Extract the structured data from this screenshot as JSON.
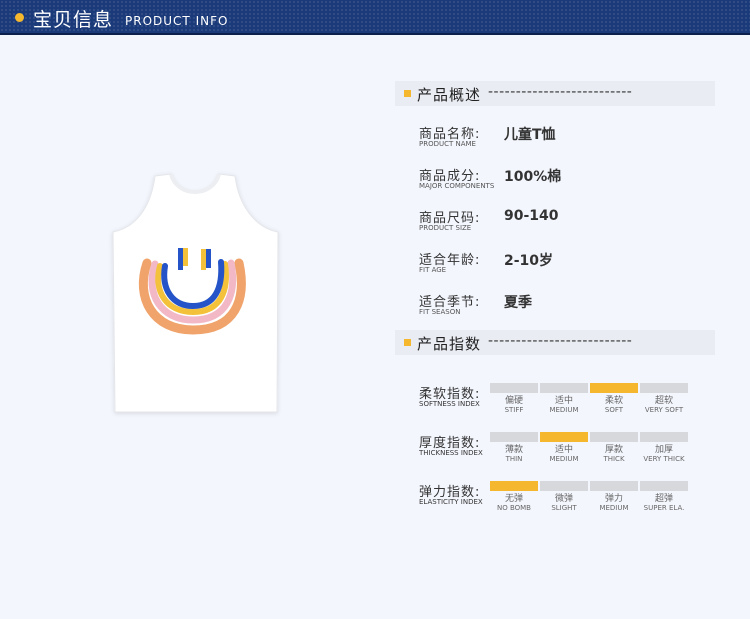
{
  "header": {
    "title_cn": "宝贝信息",
    "title_en": "PRODUCT INFO"
  },
  "overview": {
    "title": "产品概述",
    "dashes": "--------------------------",
    "rows": [
      {
        "cn": "商品名称:",
        "en": "PRODUCT NAME",
        "value": "儿童T恤"
      },
      {
        "cn": "商品成分:",
        "en": "MAJOR COMPONENTS",
        "value": "100%棉"
      },
      {
        "cn": "商品尺码:",
        "en": "PRODUCT SIZE",
        "value": "90-140"
      },
      {
        "cn": "适合年龄:",
        "en": "FIT AGE",
        "value": "2-10岁"
      },
      {
        "cn": "适合季节:",
        "en": "FIT SEASON",
        "value": "夏季"
      }
    ]
  },
  "indices": {
    "title": "产品指数",
    "dashes": "--------------------------",
    "rows": [
      {
        "cn": "柔软指数:",
        "en": "SOFTNESS INDEX",
        "selected": 2,
        "options": [
          {
            "cn": "偏硬",
            "en": "STIFF"
          },
          {
            "cn": "适中",
            "en": "MEDIUM"
          },
          {
            "cn": "柔软",
            "en": "SOFT"
          },
          {
            "cn": "超软",
            "en": "VERY SOFT"
          }
        ]
      },
      {
        "cn": "厚度指数:",
        "en": "THICKNESS INDEX",
        "selected": 1,
        "options": [
          {
            "cn": "薄款",
            "en": "THIN"
          },
          {
            "cn": "适中",
            "en": "MEDIUM"
          },
          {
            "cn": "厚款",
            "en": "THICK"
          },
          {
            "cn": "加厚",
            "en": "VERY THICK"
          }
        ]
      },
      {
        "cn": "弹力指数:",
        "en": "ELASTICITY INDEX",
        "selected": 0,
        "options": [
          {
            "cn": "无弹",
            "en": "NO BOMB"
          },
          {
            "cn": "微弹",
            "en": "SLIGHT"
          },
          {
            "cn": "弹力",
            "en": "MEDIUM"
          },
          {
            "cn": "超弹",
            "en": "SUPER ELA."
          }
        ]
      }
    ]
  },
  "colors": {
    "accent": "#f4b72e",
    "header_bg": "#1b3a7a",
    "inactive": "#d7d8dc"
  }
}
